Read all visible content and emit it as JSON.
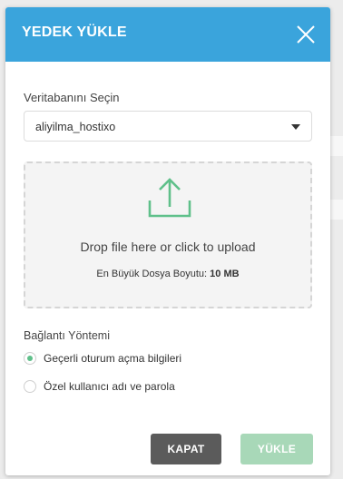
{
  "dialog": {
    "title": "YEDEK YÜKLE",
    "database_label": "Veritabanını Seçin",
    "database_value": "aliyilma_hostixo",
    "dropzone": {
      "text": "Drop file here or click to upload",
      "max_size_label": "En Büyük Dosya Boyutu:",
      "max_size_value": "10 MB"
    },
    "connection_label": "Bağlantı Yöntemi",
    "connection_options": [
      {
        "label": "Geçerli oturum açma bilgileri",
        "checked": true
      },
      {
        "label": "Özel kullanıcı adı ve parola",
        "checked": false
      }
    ],
    "buttons": {
      "close": "KAPAT",
      "upload": "YÜKLE"
    }
  },
  "colors": {
    "header": "#3aa4dc",
    "accent_green": "#5fc08a",
    "close_button": "#5b5b5b",
    "upload_button_disabled": "#a8d8b8"
  },
  "icons": {
    "close": "close-icon",
    "caret": "caret-down-icon",
    "upload": "upload-icon"
  }
}
